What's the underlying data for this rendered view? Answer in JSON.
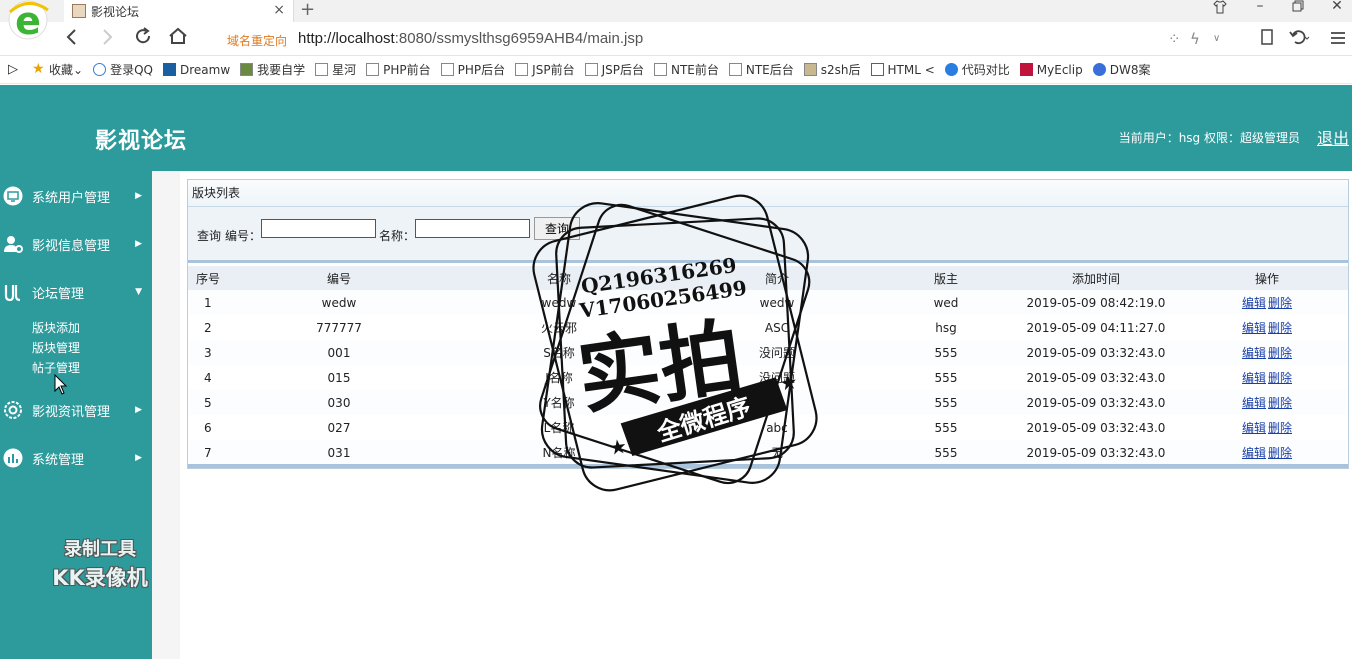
{
  "browser": {
    "tab_title": "影视论坛",
    "redirect_label": "域名重定向",
    "url_host": "http://localhost",
    "url_rest": ":8080/ssmyslthsg6959AHB4/main.jsp",
    "bookmarks": [
      "收藏",
      "登录QQ",
      "Dreamw",
      "我要自学",
      "星河",
      "PHP前台",
      "PHP后台",
      "JSP前台",
      "JSP后台",
      "NTE前台",
      "NTE后台",
      "s2sh后",
      "HTML <",
      "代码对比",
      "MyEclip",
      "DW8案"
    ]
  },
  "header": {
    "site_title": "影视论坛",
    "user_info": "当前用户：hsg 权限：超级管理员",
    "logout": "退出"
  },
  "sidebar": {
    "menus": [
      {
        "label": "系统用户管理",
        "icon": "monitor-icon"
      },
      {
        "label": "影视信息管理",
        "icon": "user-gear-icon"
      },
      {
        "label": "论坛管理",
        "icon": "forum-icon"
      },
      {
        "label": "影视资讯管理",
        "icon": "settings-icon"
      },
      {
        "label": "系统管理",
        "icon": "bar-chart-icon"
      }
    ],
    "forum_submenu": [
      "版块添加",
      "版块管理",
      "帖子管理"
    ]
  },
  "panel": {
    "title": "版块列表",
    "search": {
      "query_label": "查询",
      "code_label": "编号：",
      "name_label": "名称：",
      "button": "查询"
    },
    "columns": [
      "序号",
      "编号",
      "名称",
      "简介",
      "版主",
      "添加时间",
      "操作"
    ],
    "rows": [
      {
        "no": "1",
        "code": "wedw",
        "name": "wedw",
        "intro": "wedw",
        "moderator": "wed",
        "time": "2019-05-09 08:42:19.0"
      },
      {
        "no": "2",
        "code": "777777",
        "name": "火云邪",
        "intro": "ASC",
        "moderator": "hsg",
        "time": "2019-05-09 04:11:27.0"
      },
      {
        "no": "3",
        "code": "001",
        "name": "S名称",
        "intro": "没问题",
        "moderator": "555",
        "time": "2019-05-09 03:32:43.0"
      },
      {
        "no": "4",
        "code": "015",
        "name": "J名称",
        "intro": "没问题",
        "moderator": "555",
        "time": "2019-05-09 03:32:43.0"
      },
      {
        "no": "5",
        "code": "030",
        "name": "Y名称",
        "intro": "无",
        "moderator": "555",
        "time": "2019-05-09 03:32:43.0"
      },
      {
        "no": "6",
        "code": "027",
        "name": "L名称",
        "intro": "abc",
        "moderator": "555",
        "time": "2019-05-09 03:32:43.0"
      },
      {
        "no": "7",
        "code": "031",
        "name": "N名称",
        "intro": "无",
        "moderator": "555",
        "time": "2019-05-09 03:32:43.0"
      }
    ],
    "edit_label": "编辑",
    "delete_label": "删除"
  },
  "overlays": {
    "stamp_q": "Q2196316269",
    "stamp_v": "V17060256499",
    "stamp_main": "实拍",
    "stamp_banner": "全微程序",
    "tool_line1": "录制工具",
    "tool_line2": "KK录像机"
  },
  "colors": {
    "teal": "#2d9a9c",
    "link": "#1a3fa8"
  }
}
